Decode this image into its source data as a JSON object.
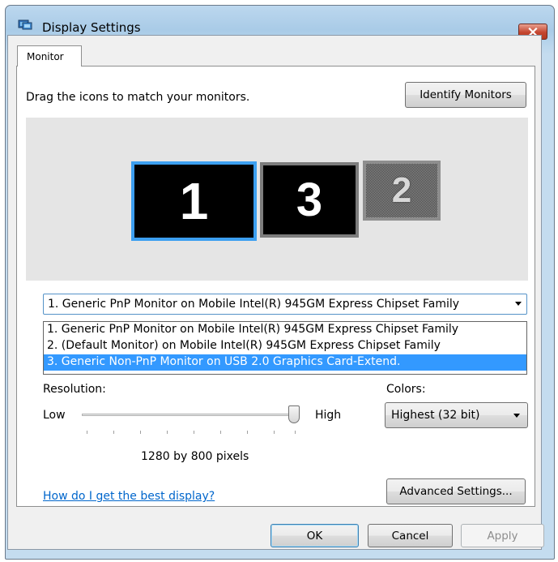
{
  "window": {
    "title": "Display Settings",
    "icon": "display-settings-icon",
    "close_icon": "close-icon"
  },
  "tabs": [
    {
      "label": "Monitor",
      "active": true
    }
  ],
  "monitor_tab": {
    "instruction": "Drag the icons to match your monitors.",
    "identify_button": "Identify Monitors",
    "monitors": [
      {
        "number": "1",
        "state": "selected"
      },
      {
        "number": "3",
        "state": "active"
      },
      {
        "number": "2",
        "state": "disabled"
      }
    ],
    "display_select": {
      "value": "1. Generic PnP Monitor on Mobile Intel(R) 945GM Express Chipset Family",
      "options": [
        "1. Generic PnP Monitor on Mobile Intel(R) 945GM Express Chipset Family",
        "2. (Default Monitor) on Mobile Intel(R) 945GM Express Chipset Family",
        "3. Generic Non-PnP Monitor on USB 2.0 Graphics Card-Extend."
      ],
      "highlighted_index": 2
    },
    "resolution": {
      "label": "Resolution:",
      "low_label": "Low",
      "high_label": "High",
      "value_text": "1280 by 800 pixels",
      "slider_level": 1.0
    },
    "colors": {
      "label": "Colors:",
      "value": "Highest (32 bit)"
    },
    "help_link": "How do I get the best display?",
    "advanced_button": "Advanced Settings..."
  },
  "buttons": {
    "ok": "OK",
    "cancel": "Cancel",
    "apply": "Apply"
  },
  "colors_palette": {
    "selection_blue": "#3399ff",
    "monitor_selected_border": "#3c9ff0",
    "link_blue": "#0066cc"
  }
}
